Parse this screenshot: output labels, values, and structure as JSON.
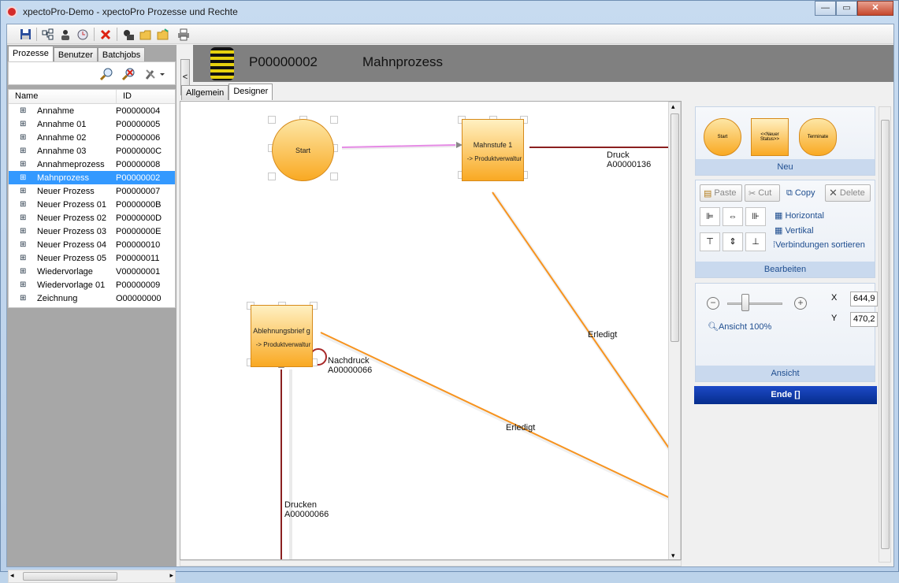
{
  "window": {
    "title": "xpectoPro-Demo - xpectoPro Prozesse und Rechte",
    "minimize": "—",
    "maximize": "▭",
    "close": "✕"
  },
  "toolbar": {
    "icons": [
      "save-icon",
      "new-icon",
      "new-user-icon",
      "history-icon",
      "delete-icon",
      "import-icon",
      "open-folder-icon",
      "open-folder-2-icon",
      "print-icon"
    ]
  },
  "left_tabs": [
    "Prozesse",
    "Benutzer",
    "Batchjobs"
  ],
  "tree": {
    "col_name": "Name",
    "col_id": "ID",
    "rows": [
      {
        "name": "Annahme",
        "id": "P00000004"
      },
      {
        "name": "Annahme 01",
        "id": "P00000005"
      },
      {
        "name": "Annahme 02",
        "id": "P00000006"
      },
      {
        "name": "Annahme 03",
        "id": "P0000000C"
      },
      {
        "name": "Annahmeprozess",
        "id": "P00000008"
      },
      {
        "name": "Mahnprozess",
        "id": "P00000002"
      },
      {
        "name": "Neuer Prozess",
        "id": "P00000007"
      },
      {
        "name": "Neuer Prozess 01",
        "id": "P0000000B"
      },
      {
        "name": "Neuer Prozess 02",
        "id": "P0000000D"
      },
      {
        "name": "Neuer Prozess 03",
        "id": "P0000000E"
      },
      {
        "name": "Neuer Prozess 04",
        "id": "P00000010"
      },
      {
        "name": "Neuer Prozess 05",
        "id": "P00000011"
      },
      {
        "name": "Wiedervorlage",
        "id": "V00000001"
      },
      {
        "name": "Wiedervorlage 01",
        "id": "P00000009"
      },
      {
        "name": "Zeichnung",
        "id": "O00000000"
      }
    ],
    "selected": "Mahnprozess"
  },
  "header": {
    "process_id": "P00000002",
    "process_name": "Mahnprozess",
    "collapse": "<"
  },
  "main_tabs": [
    "Allgemein",
    "Designer"
  ],
  "canvas": {
    "start": "Start",
    "mahnstufe_title": "Mahnstufe 1",
    "mahnstufe_sub": "-> Produktverwaltur",
    "ablehnung_title": "Ablehnungsbrief g",
    "ablehnung_sub": "-> Produktverwaltur",
    "druck_label": "Druck",
    "druck_id": "A00000136",
    "erledigt_1": "Erledigt",
    "erledigt_2": "Erledigt",
    "nachdruck_label": "Nachdruck",
    "nachdruck_id": "A00000066",
    "drucken_label": "Drucken",
    "drucken_id": "A00000066"
  },
  "right": {
    "palette": {
      "start": "Start",
      "status": "<<Neuer Status>>",
      "terminate": "Terminate",
      "title": "Neu"
    },
    "edit": {
      "paste": "Paste",
      "cut": "Cut",
      "copy": "Copy",
      "delete": "Delete",
      "horizontal": "Horizontal",
      "vertical": "Vertikal",
      "sort": "Verbindungen sortieren",
      "title": "Bearbeiten"
    },
    "view": {
      "zoom_label": "Ansicht 100%",
      "zoom_level": 0.3,
      "x_label": "X",
      "y_label": "Y",
      "x_value": "644,9",
      "y_value": "470,2",
      "title": "Ansicht"
    },
    "ende": "Ende []"
  },
  "colors": {
    "selection": "#3399ff",
    "node_orange": "#f9a923",
    "edge_dark": "#8b2020",
    "edge_orange": "#f7931e",
    "edge_pink": "#e64ce6",
    "ende_blue": "#0a34a3"
  }
}
